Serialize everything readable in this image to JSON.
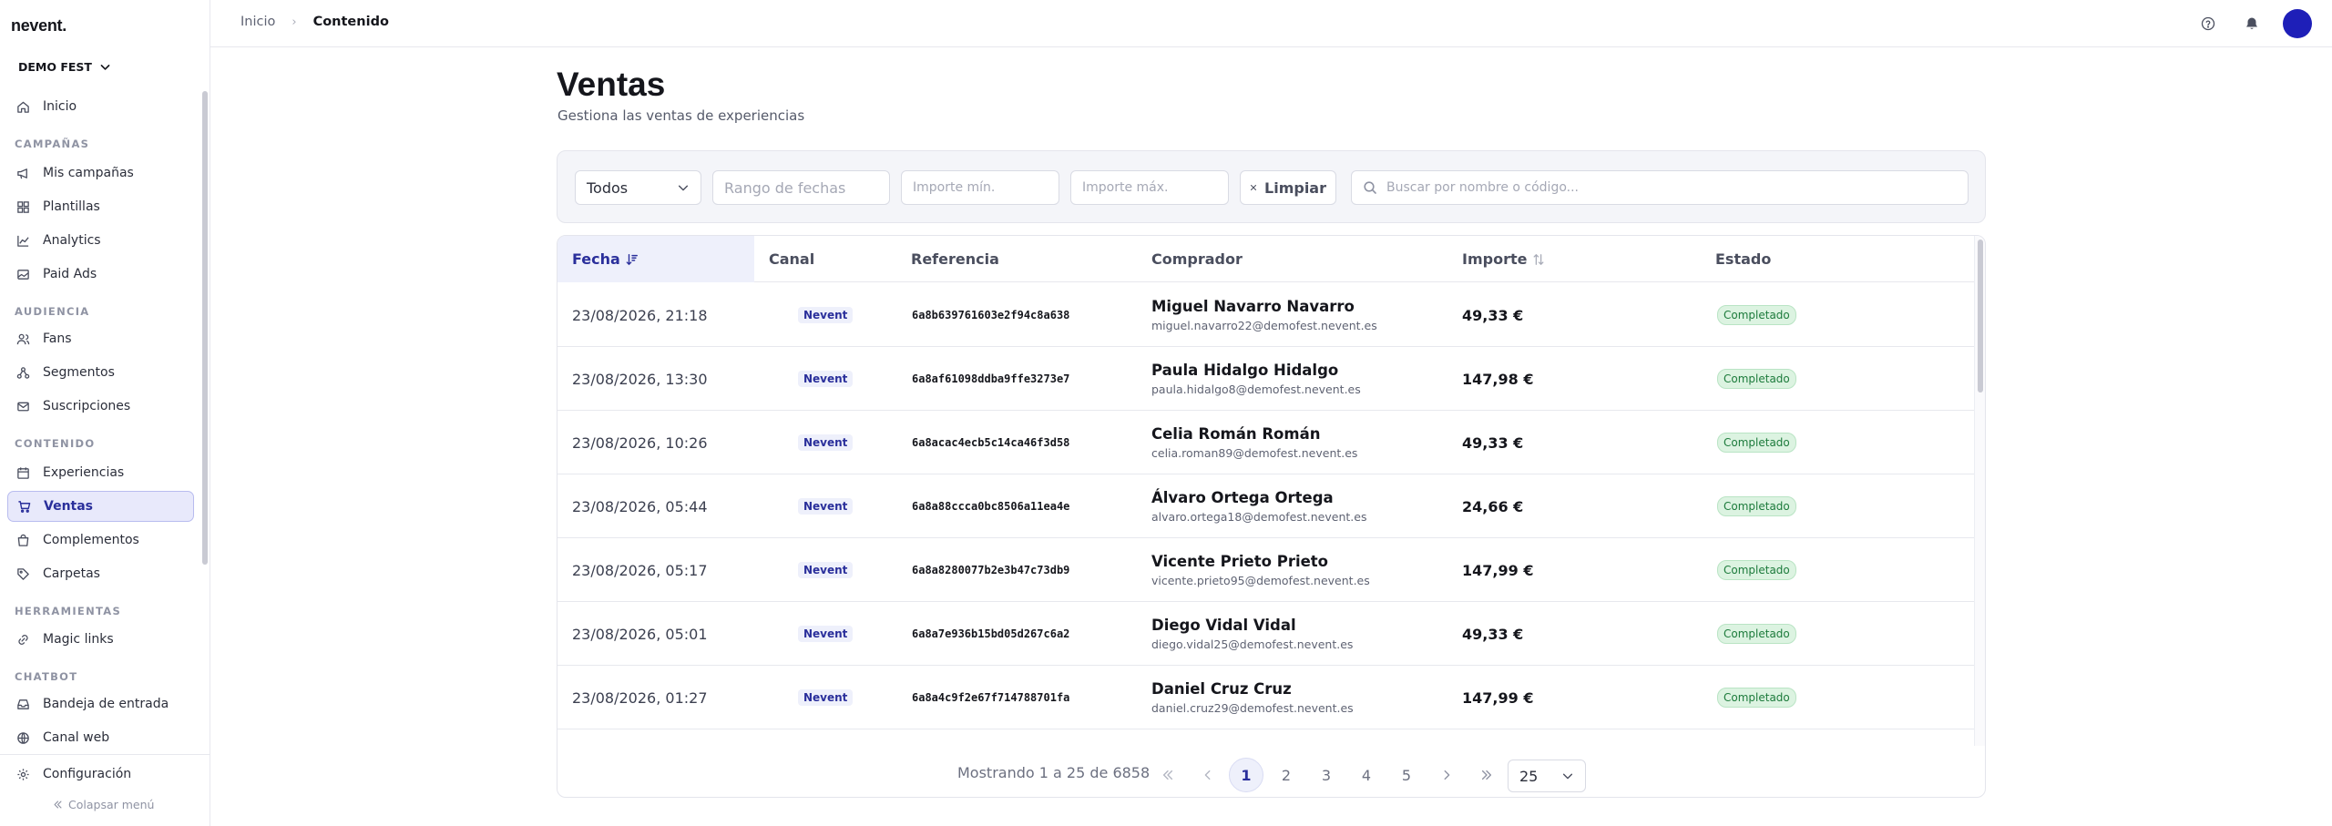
{
  "brand": {
    "logo": "nevent."
  },
  "org": {
    "name": "DEMO FEST"
  },
  "sidebar": {
    "home": "Inicio",
    "sections": [
      {
        "title": "CAMPAÑAS",
        "items": [
          "Mis campañas",
          "Plantillas",
          "Analytics",
          "Paid Ads"
        ]
      },
      {
        "title": "AUDIENCIA",
        "items": [
          "Fans",
          "Segmentos",
          "Suscripciones"
        ]
      },
      {
        "title": "CONTENIDO",
        "items": [
          "Experiencias",
          "Ventas",
          "Complementos",
          "Carpetas"
        ]
      },
      {
        "title": "HERRAMIENTAS",
        "items": [
          "Magic links"
        ]
      },
      {
        "title": "CHATBOT",
        "items": [
          "Bandeja de entrada",
          "Canal web"
        ]
      }
    ],
    "active_item": "Ventas",
    "settings": "Configuración",
    "collapse": "Colapsar menú"
  },
  "breadcrumb": {
    "first": "Inicio",
    "sep": "›",
    "current": "Contenido"
  },
  "page": {
    "title": "Ventas",
    "subtitle": "Gestiona las ventas de experiencias"
  },
  "filters": {
    "status": "Todos",
    "date_placeholder": "Rango de fechas",
    "min_placeholder": "Importe mín.",
    "max_placeholder": "Importe máx.",
    "clear": "Limpiar",
    "search_placeholder": "Buscar por nombre o código..."
  },
  "table": {
    "columns": {
      "date": "Fecha",
      "channel": "Canal",
      "reference": "Referencia",
      "buyer": "Comprador",
      "amount": "Importe",
      "status": "Estado"
    },
    "rows": [
      {
        "date": "23/08/2026, 21:18",
        "channel": "Nevent",
        "reference": "6a8b639761603e2f94c8a638",
        "name": "Miguel Navarro Navarro",
        "email": "miguel.navarro22@demofest.nevent.es",
        "amount": "49,33 €",
        "status": "Completado"
      },
      {
        "date": "23/08/2026, 13:30",
        "channel": "Nevent",
        "reference": "6a8af61098ddba9ffe3273e7",
        "name": "Paula Hidalgo Hidalgo",
        "email": "paula.hidalgo8@demofest.nevent.es",
        "amount": "147,98 €",
        "status": "Completado"
      },
      {
        "date": "23/08/2026, 10:26",
        "channel": "Nevent",
        "reference": "6a8acac4ecb5c14ca46f3d58",
        "name": "Celia Román Román",
        "email": "celia.roman89@demofest.nevent.es",
        "amount": "49,33 €",
        "status": "Completado"
      },
      {
        "date": "23/08/2026, 05:44",
        "channel": "Nevent",
        "reference": "6a8a88ccca0bc8506a11ea4e",
        "name": "Álvaro Ortega Ortega",
        "email": "alvaro.ortega18@demofest.nevent.es",
        "amount": "24,66 €",
        "status": "Completado"
      },
      {
        "date": "23/08/2026, 05:17",
        "channel": "Nevent",
        "reference": "6a8a8280077b2e3b47c73db9",
        "name": "Vicente Prieto Prieto",
        "email": "vicente.prieto95@demofest.nevent.es",
        "amount": "147,99 €",
        "status": "Completado"
      },
      {
        "date": "23/08/2026, 05:01",
        "channel": "Nevent",
        "reference": "6a8a7e936b15bd05d267c6a2",
        "name": "Diego Vidal Vidal",
        "email": "diego.vidal25@demofest.nevent.es",
        "amount": "49,33 €",
        "status": "Completado"
      },
      {
        "date": "23/08/2026, 01:27",
        "channel": "Nevent",
        "reference": "6a8a4c9f2e67f714788701fa",
        "name": "Daniel Cruz Cruz",
        "email": "daniel.cruz29@demofest.nevent.es",
        "amount": "147,99 €",
        "status": "Completado"
      }
    ]
  },
  "pagination": {
    "info": "Mostrando 1 a 25 de 6858",
    "pages": [
      "1",
      "2",
      "3",
      "4",
      "5"
    ],
    "current": "1",
    "page_size": "25"
  },
  "colors": {
    "accent": "#2a2f9b",
    "avatar": "#1e1fb8",
    "success": "#1d7b3c"
  }
}
